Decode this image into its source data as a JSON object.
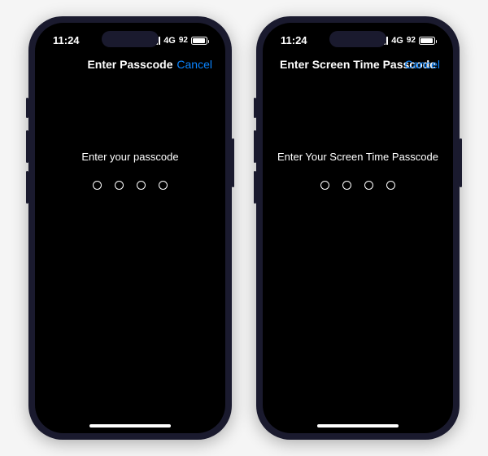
{
  "phones": [
    {
      "statusBar": {
        "time": "11:24",
        "network": "4G",
        "battery": "92"
      },
      "navBar": {
        "title": "Enter Passcode",
        "cancel": "Cancel"
      },
      "content": {
        "prompt": "Enter your passcode"
      }
    },
    {
      "statusBar": {
        "time": "11:24",
        "network": "4G",
        "battery": "92"
      },
      "navBar": {
        "title": "Enter Screen Time Passcode",
        "cancel": "Cancel"
      },
      "content": {
        "prompt": "Enter Your Screen Time Passcode"
      }
    }
  ],
  "colors": {
    "accent": "#0a84ff",
    "text": "#ffffff",
    "background": "#000000"
  }
}
